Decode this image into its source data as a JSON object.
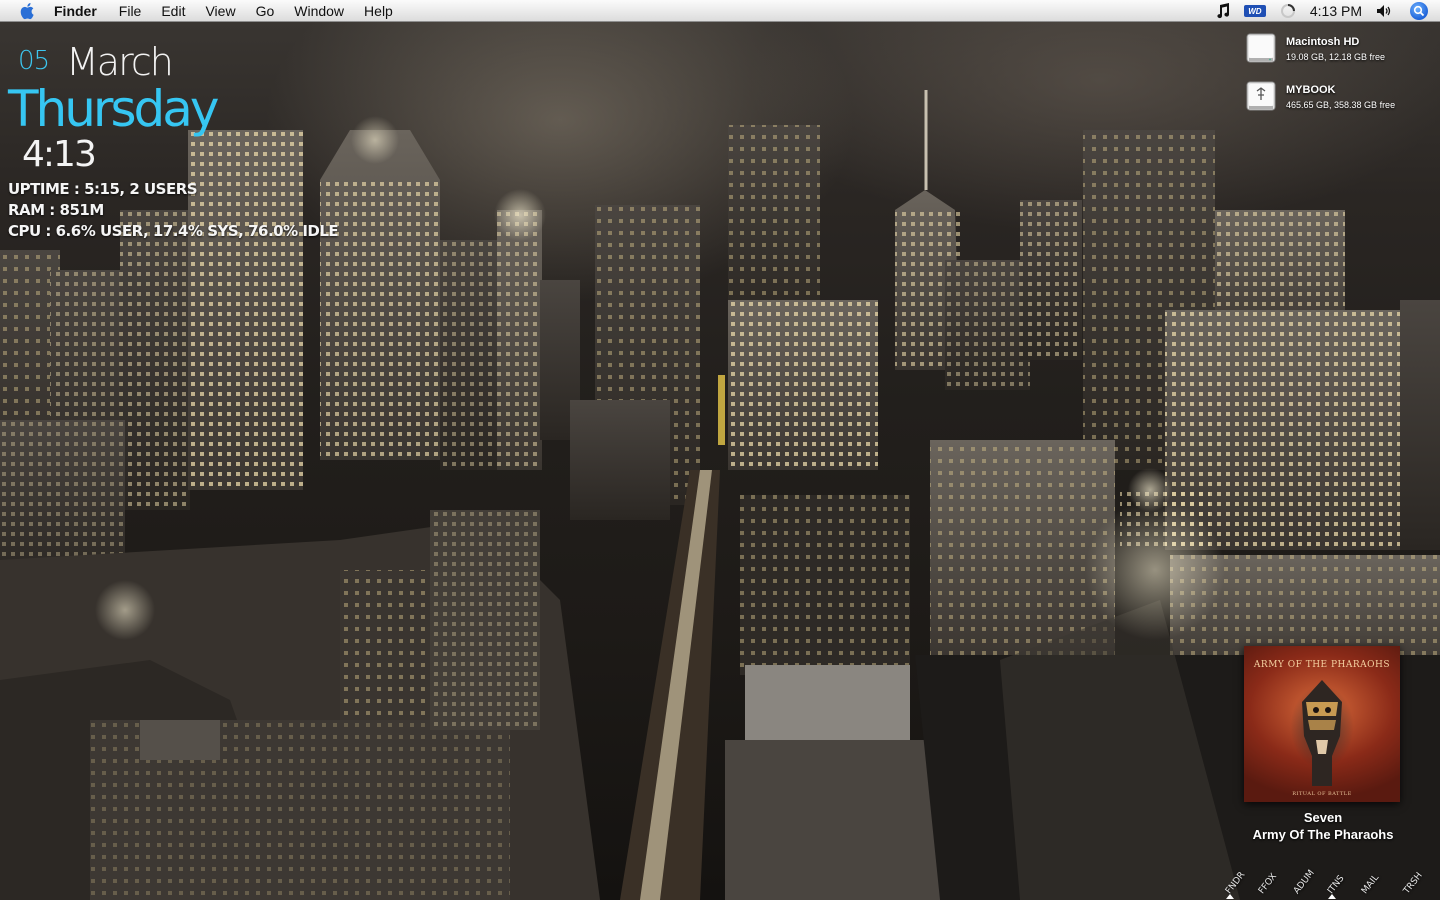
{
  "menubar": {
    "apple_icon": "apple-icon",
    "app_name": "Finder",
    "items": [
      "File",
      "Edit",
      "View",
      "Go",
      "Window",
      "Help"
    ],
    "clock": "4:13 PM",
    "status_icons": [
      "itunes-note-icon",
      "wd-drive-icon",
      "activity-spinner-icon",
      "volume-icon",
      "spotlight-icon"
    ],
    "wd_label": "WD"
  },
  "widget": {
    "day_num": "05",
    "month": "March",
    "weekday": "Thursday",
    "time": "4:13",
    "uptime": "UPTIME : 5:15, 2 USERS",
    "ram": "RAM : 851M",
    "cpu": "CPU : 6.6% USER, 17.4% SYS, 76.0% IDLE",
    "accent_color": "#36c6f2"
  },
  "drives": [
    {
      "name": "Macintosh HD",
      "info": "19.08 GB, 12.18 GB free",
      "icon": "hard-drive-icon"
    },
    {
      "name": "MYBOOK",
      "info": "465.65 GB, 358.38 GB free",
      "icon": "external-drive-icon"
    }
  ],
  "now_playing": {
    "track": "Seven",
    "artist": "Army Of The Pharaohs",
    "album_cover_title": "ARMY OF THE PHARAOHS",
    "album_cover_sub": "RITUAL OF BATTLE"
  },
  "dock": {
    "items": [
      {
        "label": "FNDR",
        "running": true
      },
      {
        "label": "FFOX",
        "running": false
      },
      {
        "label": "ADUM",
        "running": false
      },
      {
        "label": "ITNS",
        "running": true
      },
      {
        "label": "MAIL",
        "running": false
      },
      {
        "label": "TRSH",
        "running": false
      }
    ]
  }
}
